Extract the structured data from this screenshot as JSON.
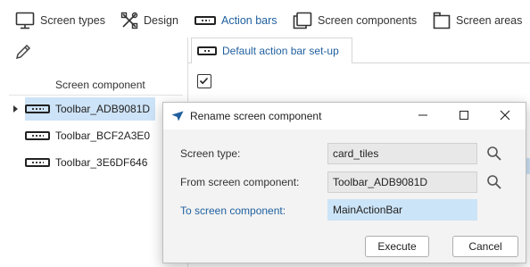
{
  "toolbar": {
    "items": [
      {
        "label": "Screen types",
        "icon": "monitor-icon"
      },
      {
        "label": "Design",
        "icon": "tools-icon"
      },
      {
        "label": "Action bars",
        "icon": "action-bar-icon",
        "active": true
      },
      {
        "label": "Screen components",
        "icon": "screen-component-icon"
      },
      {
        "label": "Screen areas",
        "icon": "screen-area-icon"
      }
    ],
    "edit_icon": "pencil-icon"
  },
  "tree": {
    "header": "Screen component",
    "items": [
      {
        "label": "Toolbar_ADB9081D",
        "selected": true
      },
      {
        "label": "Toolbar_BCF2A3E0",
        "selected": false
      },
      {
        "label": "Toolbar_3E6DF646",
        "selected": false
      }
    ]
  },
  "panel": {
    "tab_label": "Default action bar set-up"
  },
  "dialog": {
    "title": "Rename screen component",
    "fields": {
      "screen_type": {
        "label": "Screen type:",
        "value": "card_tiles"
      },
      "from": {
        "label": "From screen component:",
        "value": "Toolbar_ADB9081D"
      },
      "to": {
        "label": "To screen component:",
        "value": "MainActionBar"
      }
    },
    "execute_label": "Execute",
    "cancel_label": "Cancel"
  },
  "colors": {
    "accent": "#1f5f9e",
    "selection": "#cde3f7",
    "input_highlight": "#cce4f7"
  }
}
